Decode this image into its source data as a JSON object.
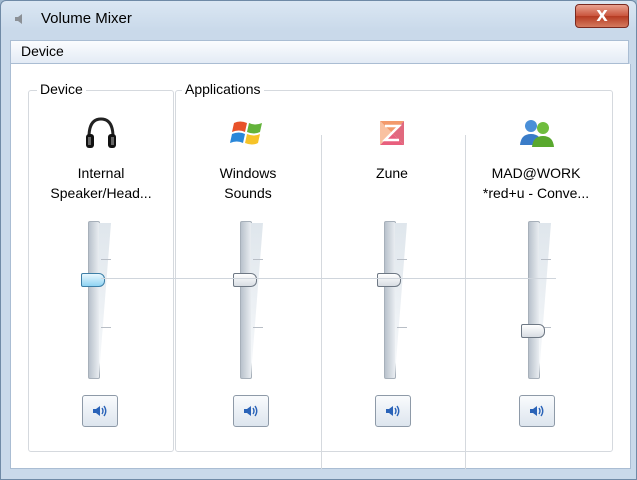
{
  "window": {
    "title": "Volume Mixer",
    "close_label": "X"
  },
  "menu": {
    "device_label": "Device"
  },
  "groups": {
    "device": "Device",
    "applications": "Applications"
  },
  "channels": [
    {
      "label_line1": "Internal",
      "label_line2": "Speaker/Head...",
      "icon": "headphones-icon",
      "level_percent": 63,
      "active": true
    },
    {
      "label_line1": "Windows",
      "label_line2": "Sounds",
      "icon": "windows-logo-icon",
      "level_percent": 63,
      "active": false
    },
    {
      "label_line1": "Zune",
      "label_line2": "",
      "icon": "zune-logo-icon",
      "level_percent": 63,
      "active": false
    },
    {
      "label_line1": "MAD@WORK",
      "label_line2": "*red+u - Conve...",
      "icon": "messenger-users-icon",
      "level_percent": 30,
      "active": false
    }
  ]
}
